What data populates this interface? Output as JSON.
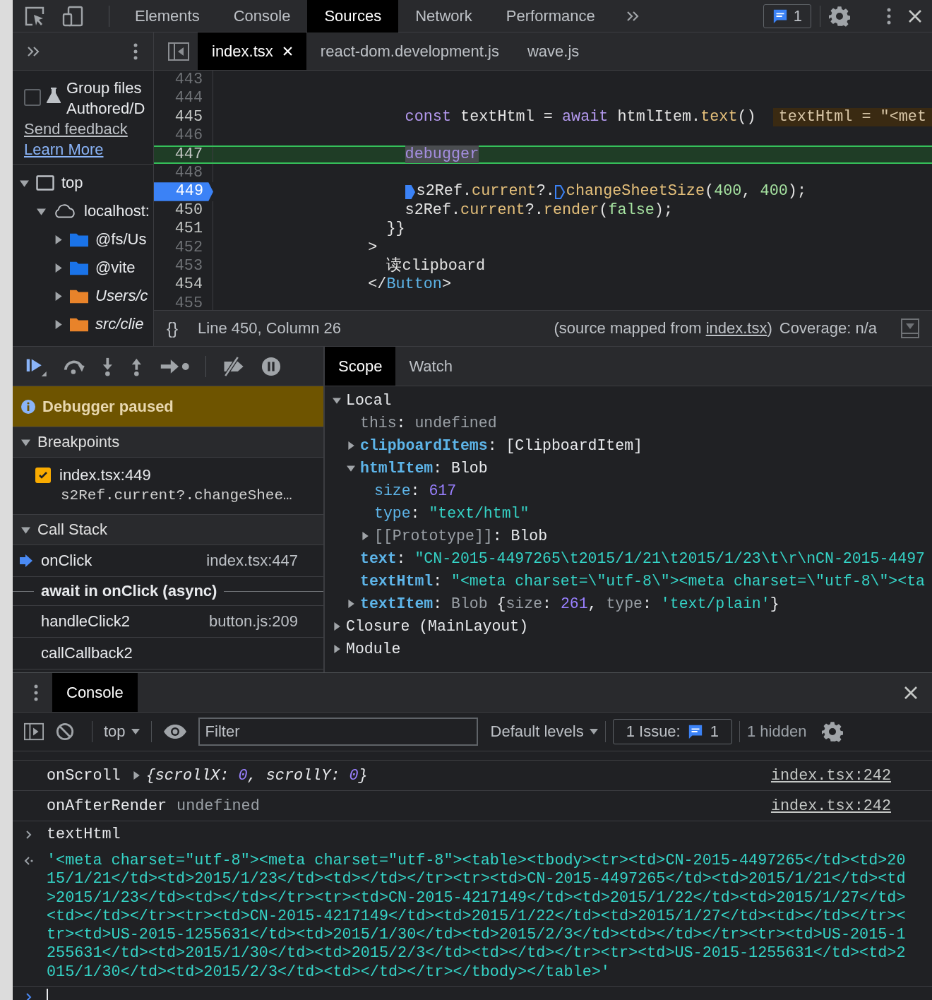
{
  "toolbar": {
    "tabs": [
      {
        "label": "Elements",
        "selected": false
      },
      {
        "label": "Console",
        "selected": false
      },
      {
        "label": "Sources",
        "selected": true
      },
      {
        "label": "Network",
        "selected": false
      },
      {
        "label": "Performance",
        "selected": false
      }
    ],
    "issues_count": "1"
  },
  "navigator": {
    "group_label_lines": [
      "Group files",
      "Authored/D"
    ],
    "group_checked": false,
    "feedback_link": "Send feedback",
    "learn_link": "Learn More",
    "tree": [
      {
        "label": "top",
        "kind": "frame",
        "expanded": true,
        "children": [
          {
            "label": "localhost:",
            "kind": "origin",
            "expanded": true,
            "children": [
              {
                "label": "@fs/Us",
                "kind": "folder",
                "color": "#1a73e8",
                "italic": false,
                "expanded": false
              },
              {
                "label": "@vite",
                "kind": "folder",
                "color": "#1a73e8",
                "italic": false,
                "expanded": false
              },
              {
                "label": "Users/c",
                "kind": "folder",
                "color": "#e8832a",
                "italic": true,
                "expanded": false
              },
              {
                "label": "src/clie",
                "kind": "folder",
                "color": "#e8832a",
                "italic": true,
                "expanded": false
              }
            ]
          }
        ]
      }
    ]
  },
  "editor": {
    "tabs": [
      {
        "label": "index.tsx",
        "selected": true,
        "closable": true
      },
      {
        "label": "react-dom.development.js",
        "selected": false,
        "closable": false
      },
      {
        "label": "wave.js",
        "selected": false,
        "closable": false
      }
    ],
    "lines": [
      {
        "number": "443",
        "executable": false,
        "paused": false,
        "breakpoint": false
      },
      {
        "number": "444",
        "executable": false,
        "paused": false,
        "breakpoint": false
      },
      {
        "number": "445",
        "executable": true,
        "paused": false,
        "breakpoint": false,
        "tokens": [
          {
            "kind": "keyword",
            "text": "                    const"
          },
          {
            "kind": "plain",
            "text": " textHtml = "
          },
          {
            "kind": "keyword",
            "text": "await"
          },
          {
            "kind": "plain",
            "text": " htmlItem."
          },
          {
            "kind": "prop",
            "text": "text"
          },
          {
            "kind": "plain",
            "text": "()"
          }
        ],
        "inline_value": "textHtml = \"<met"
      },
      {
        "number": "446",
        "executable": false,
        "paused": false,
        "breakpoint": false
      },
      {
        "number": "447",
        "executable": true,
        "paused": true,
        "breakpoint": false,
        "tokens": [
          {
            "kind": "exec",
            "text": "                    debugger"
          }
        ]
      },
      {
        "number": "448",
        "executable": false,
        "paused": false,
        "breakpoint": false
      },
      {
        "number": "449",
        "executable": true,
        "paused": false,
        "breakpoint": true,
        "tokens": [
          {
            "kind": "marker",
            "active": true
          },
          {
            "kind": "plain",
            "text": "                    s2Ref."
          },
          {
            "kind": "prop",
            "text": "current"
          },
          {
            "kind": "plain",
            "text": "?."
          },
          {
            "kind": "marker",
            "active": false
          },
          {
            "kind": "prop",
            "text": "changeSheetSize"
          },
          {
            "kind": "plain",
            "text": "("
          },
          {
            "kind": "number",
            "text": "400"
          },
          {
            "kind": "plain",
            "text": ", "
          },
          {
            "kind": "number",
            "text": "400"
          },
          {
            "kind": "plain",
            "text": ");"
          }
        ]
      },
      {
        "number": "450",
        "executable": true,
        "paused": false,
        "breakpoint": false,
        "tokens": [
          {
            "kind": "plain",
            "text": "                    s2Ref."
          },
          {
            "kind": "prop",
            "text": "current"
          },
          {
            "kind": "plain",
            "text": "?."
          },
          {
            "kind": "prop",
            "text": "render"
          },
          {
            "kind": "plain",
            "text": "("
          },
          {
            "kind": "number",
            "text": "false"
          },
          {
            "kind": "plain",
            "text": ");"
          }
        ]
      },
      {
        "number": "451",
        "executable": true,
        "paused": false,
        "breakpoint": false,
        "tokens": [
          {
            "kind": "plain",
            "text": "                  }}"
          }
        ]
      },
      {
        "number": "452",
        "executable": false,
        "paused": false,
        "breakpoint": false,
        "tokens": [
          {
            "kind": "plain",
            "text": "                >"
          }
        ]
      },
      {
        "number": "453",
        "executable": false,
        "paused": false,
        "breakpoint": false,
        "tokens": [
          {
            "kind": "plain",
            "text": "                  读clipboard"
          }
        ]
      },
      {
        "number": "454",
        "executable": true,
        "paused": false,
        "breakpoint": false,
        "tokens": [
          {
            "kind": "plain",
            "text": "                </"
          },
          {
            "kind": "tag",
            "text": "Button"
          },
          {
            "kind": "plain",
            "text": ">"
          }
        ]
      },
      {
        "number": "455",
        "executable": false,
        "paused": false,
        "breakpoint": false
      }
    ],
    "status": {
      "pretty": "{}",
      "position": "Line 450, Column 26",
      "mapped_prefix": "(source mapped from",
      "mapped_link": "index.tsx",
      "mapped_suffix": ")",
      "coverage": "Coverage: n/a"
    }
  },
  "debugger": {
    "banner": "Debugger paused",
    "sections": [
      {
        "label": "Breakpoints",
        "expanded": true,
        "kind": "breakpoints",
        "items": [
          {
            "file": "index.tsx:449",
            "code": "s2Ref.current?.changeShee…",
            "checked": true
          }
        ]
      },
      {
        "label": "Call Stack",
        "expanded": true,
        "kind": "callstack",
        "items": [
          {
            "kind": "frame",
            "name": "onClick",
            "location": "index.tsx:447",
            "current": true
          },
          {
            "kind": "async",
            "name": "await in onClick (async)"
          },
          {
            "kind": "frame",
            "name": "handleClick2",
            "location": "button.js:209",
            "current": false
          },
          {
            "kind": "frame",
            "name": "callCallback2",
            "current": false
          }
        ]
      }
    ]
  },
  "scope": {
    "tabs": [
      {
        "label": "Scope",
        "selected": true
      },
      {
        "label": "Watch",
        "selected": false
      }
    ],
    "entries": [
      {
        "expanded": true,
        "tokens": [
          {
            "kind": "plain",
            "text": "Local"
          }
        ],
        "children": [
          {
            "tokens": [
              {
                "kind": "dimkey",
                "text": "this"
              },
              {
                "kind": "plain",
                "text": ": "
              },
              {
                "kind": "dim",
                "text": "undefined"
              }
            ]
          },
          {
            "expanded": false,
            "tokens": [
              {
                "kind": "own",
                "text": "clipboardItems"
              },
              {
                "kind": "plain",
                "text": ": [ClipboardItem]"
              }
            ]
          },
          {
            "expanded": true,
            "tokens": [
              {
                "kind": "own",
                "text": "htmlItem"
              },
              {
                "kind": "plain",
                "text": ": Blob"
              }
            ],
            "children": [
              {
                "tokens": [
                  {
                    "kind": "key",
                    "text": "size"
                  },
                  {
                    "kind": "plain",
                    "text": ": "
                  },
                  {
                    "kind": "number",
                    "text": "617"
                  }
                ]
              },
              {
                "tokens": [
                  {
                    "kind": "key",
                    "text": "type"
                  },
                  {
                    "kind": "plain",
                    "text": ": "
                  },
                  {
                    "kind": "string",
                    "text": "\"text/html\""
                  }
                ]
              },
              {
                "expanded": false,
                "tokens": [
                  {
                    "kind": "dim",
                    "text": "[[Prototype]]"
                  },
                  {
                    "kind": "plain",
                    "text": ": Blob"
                  }
                ]
              }
            ]
          },
          {
            "tokens": [
              {
                "kind": "own",
                "text": "text"
              },
              {
                "kind": "plain",
                "text": ": "
              },
              {
                "kind": "string",
                "text": "\"CN-2015-4497265\\t2015/1/21\\t2015/1/23\\t\\r\\nCN-2015-4497"
              }
            ]
          },
          {
            "tokens": [
              {
                "kind": "own",
                "text": "textHtml"
              },
              {
                "kind": "plain",
                "text": ": "
              },
              {
                "kind": "string",
                "text": "\"<meta charset=\\\"utf-8\\\"><meta charset=\\\"utf-8\\\"><ta"
              }
            ]
          },
          {
            "expanded": false,
            "tokens": [
              {
                "kind": "own",
                "text": "textItem"
              },
              {
                "kind": "plain",
                "text": ": "
              },
              {
                "kind": "dim",
                "text": "Blob "
              },
              {
                "kind": "plain",
                "text": "{"
              },
              {
                "kind": "dim",
                "text": "size"
              },
              {
                "kind": "plain",
                "text": ": "
              },
              {
                "kind": "number",
                "text": "261"
              },
              {
                "kind": "plain",
                "text": ", "
              },
              {
                "kind": "dim",
                "text": "type"
              },
              {
                "kind": "plain",
                "text": ": "
              },
              {
                "kind": "string",
                "text": "'text/plain'"
              },
              {
                "kind": "plain",
                "text": "}"
              }
            ]
          }
        ]
      },
      {
        "expanded": false,
        "tokens": [
          {
            "kind": "plain",
            "text": "Closure (MainLayout)"
          }
        ]
      },
      {
        "expanded": false,
        "tokens": [
          {
            "kind": "plain",
            "text": "Module"
          }
        ]
      }
    ]
  },
  "console": {
    "tab": "Console",
    "context": "top",
    "filter_placeholder": "Filter",
    "levels": "Default levels",
    "issues_label": "1 Issue:",
    "issues_count": "1",
    "hidden": "1 hidden",
    "messages": [
      {
        "kind": "log",
        "text": "onScroll",
        "expanded": false,
        "value": [
          {
            "kind": "preview",
            "text": "{scrollX: "
          },
          {
            "kind": "pnum",
            "text": "0"
          },
          {
            "kind": "preview",
            "text": ", scrollY: "
          },
          {
            "kind": "pnum",
            "text": "0"
          },
          {
            "kind": "preview",
            "text": "}"
          }
        ],
        "source": "index.tsx:242"
      },
      {
        "kind": "log",
        "text": "onAfterRender",
        "value": [
          {
            "kind": "dim",
            "text": "undefined"
          }
        ],
        "source": "index.tsx:242"
      },
      {
        "kind": "input",
        "text": "textHtml"
      },
      {
        "kind": "result",
        "text": "'<meta charset=\"utf-8\"><meta charset=\"utf-8\"><table><tbody><tr><td>CN-2015-4497265</td><td>2015/1/21</td><td>2015/1/23</td><td></td></tr><tr><td>CN-2015-4497265</td><td>2015/1/21</td><td>2015/1/23</td><td></td></tr><tr><td>CN-2015-4217149</td><td>2015/1/22</td><td>2015/1/27</td><td></td></tr><tr><td>CN-2015-4217149</td><td>2015/1/22</td><td>2015/1/27</td><td></td></tr><tr><td>US-2015-1255631</td><td>2015/1/30</td><td>2015/2/3</td><td></td></tr><tr><td>US-2015-1255631</td><td>2015/1/30</td><td>2015/2/3</td><td></td></tr><tr><td>US-2015-1255631</td><td>2015/1/30</td><td>2015/2/3</td><td></td></tr></tbody></table>'"
      },
      {
        "kind": "prompt"
      }
    ]
  }
}
